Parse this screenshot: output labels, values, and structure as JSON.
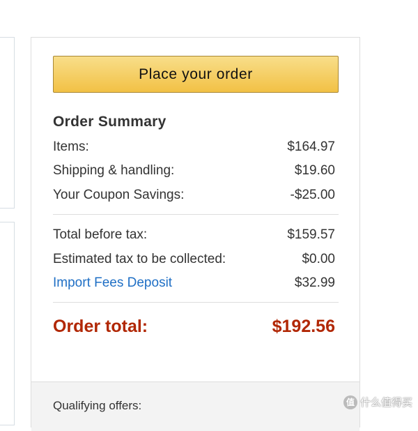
{
  "place_order_label": "Place your order",
  "summary": {
    "title": "Order Summary",
    "rows": [
      {
        "label": "Items:",
        "value": "$164.97"
      },
      {
        "label": "Shipping & handling:",
        "value": "$19.60"
      },
      {
        "label": "Your Coupon Savings:",
        "value": "-$25.00"
      },
      {
        "label": "Total before tax:",
        "value": "$159.57"
      },
      {
        "label": "Estimated tax to be collected:",
        "value": "$0.00"
      },
      {
        "label": "Import Fees Deposit",
        "value": "$32.99"
      }
    ],
    "total": {
      "label": "Order total:",
      "value": "$192.56"
    }
  },
  "footer": {
    "qualifying_offers": "Qualifying offers:"
  },
  "watermark": {
    "icon_text": "值",
    "text": "什么值得买"
  },
  "colors": {
    "button_top": "#f8de8a",
    "button_bottom": "#f2c145",
    "link": "#1f6fc5",
    "total": "#b12704"
  }
}
